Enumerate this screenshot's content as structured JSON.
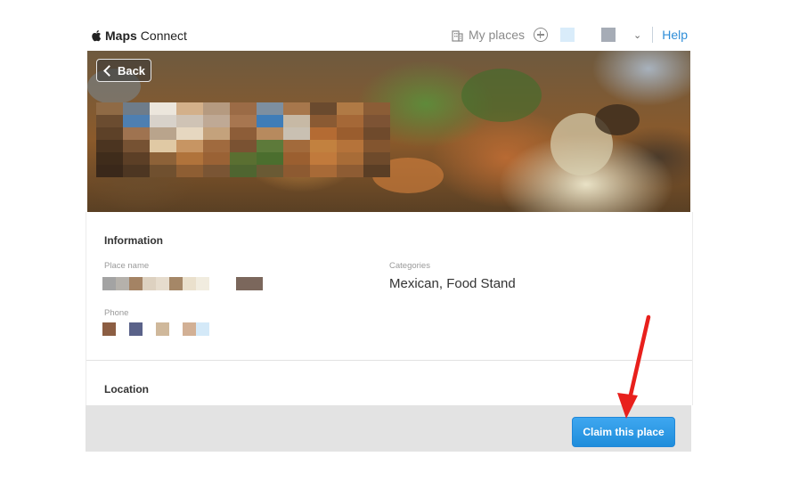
{
  "header": {
    "brand_bold": "Maps",
    "brand_regular": "Connect",
    "my_places": "My places",
    "help": "Help"
  },
  "hero": {
    "back_label": "Back"
  },
  "information": {
    "heading": "Information",
    "place_name_label": "Place name",
    "categories_label": "Categories",
    "categories_value": "Mexican, Food Stand",
    "phone_label": "Phone"
  },
  "location": {
    "heading": "Location"
  },
  "footer": {
    "claim_label": "Claim this place"
  },
  "colors": {
    "accent": "#1f8ddb",
    "annotation_arrow": "#e8201c"
  }
}
